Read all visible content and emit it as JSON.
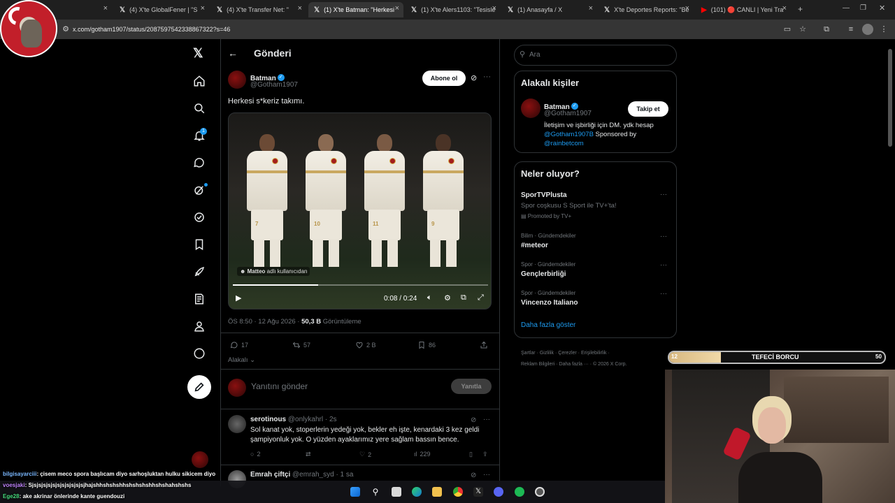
{
  "browser": {
    "tabs": [
      {
        "label": "X'te GlobalFener | \"S",
        "icon": "x-logo"
      },
      {
        "label": "(4) X'te GlobalFener | \"S",
        "icon": "x-logo"
      },
      {
        "label": "(4) X'te Transfer Net: \"",
        "icon": "x-logo"
      },
      {
        "label": "(1) X'te Batman: \"Herkesi",
        "icon": "x-logo",
        "active": true
      },
      {
        "label": "(1) X'te Alers1103: \"Tesisle",
        "icon": "x-logo"
      },
      {
        "label": "(1) Anasayfa / X",
        "icon": "x-logo"
      },
      {
        "label": "X'te Deportes Reports: \"Be",
        "icon": "x-logo"
      },
      {
        "label": "(101) 🔴 CANLI | Yeni Tra",
        "icon": "youtube-logo"
      }
    ],
    "new_tab": "+",
    "url": "x.com/gotham1907/status/2087597542338867322?s=46"
  },
  "sidebar": {
    "notification_count": "1",
    "items": [
      "home-icon",
      "search-icon",
      "bell-icon",
      "message-icon",
      "grok-icon",
      "verified-icon",
      "bookmark-icon",
      "rocket-icon",
      "list-icon",
      "profile-icon",
      "more-icon"
    ]
  },
  "post": {
    "header_title": "Gönderi",
    "back": "←",
    "author_name": "Batman",
    "author_handle": "@Gotham1907",
    "subscribe_label": "Abone ol",
    "text": "Herkesi s*keriz takımı.",
    "video": {
      "credit_user": "Matteo",
      "credit_suffix": "adlı kullanıcıdan",
      "time": "0:08 / 0:24",
      "progress": 0.333,
      "jersey_numbers": [
        "7",
        "10",
        "11",
        "9"
      ]
    },
    "meta_time": "ÖS 8:50 · 12 Ağu 2026 · ",
    "views": "50,3 B",
    "views_label": "Görüntüleme",
    "actions": {
      "replies": "17",
      "reposts": "57",
      "likes": "2 B",
      "bookmarks": "86"
    },
    "related": "Alakalı",
    "reply_placeholder": "Yanıtını gönder",
    "reply_button": "Yanıtla"
  },
  "comments": [
    {
      "name": "serotinous",
      "handle": "@onlykahrl",
      "age": "· 2s",
      "text": "Sol kanat yok, stoperlerin yedeği yok, bekler eh işte, kenardaki 3 kez geldi şampiyonluk yok. O yüzden ayaklarımız yere sağlam bassın bence.",
      "replies": "2",
      "likes": "2",
      "views": "229"
    },
    {
      "name": "Emrah çiftçi",
      "handle": "@emrah_syd",
      "age": "· 1 sa"
    }
  ],
  "right": {
    "search_placeholder": "Ara",
    "people_title": "Alakalı kişiler",
    "person": {
      "name": "Batman",
      "handle": "@Gotham1907",
      "follow_label": "Takip et",
      "bio_1": "İletişim ve işbirliği için DM. ydk hesap",
      "bio_link": "@Gotham1907B",
      "bio_2": " Sponsored by",
      "bio_link2": "@rainbetcom"
    },
    "trends_title": "Neler oluyor?",
    "promo": {
      "name": "SporTVPlusta",
      "desc": "Spor coşkusu S Sport ile TV+'ta!",
      "promoted": "Promoted by TV+"
    },
    "trends": [
      {
        "category": "Bilim · Gündemdekiler",
        "name": "#meteor"
      },
      {
        "category": "Spor · Gündemdekiler",
        "name": "Gençlerbirliği"
      },
      {
        "category": "Spor · Gündemdekiler",
        "name": "Vincenzo Italiano"
      }
    ],
    "show_more": "Daha fazla göster",
    "footer_1": "Şartlar · Gizlilik · Çerezler · Erişilebilirlik ·",
    "footer_2": "Reklam Bilgileri · Daha fazla ··· · © 2026 X Corp."
  },
  "overlay": {
    "debt_left": "12",
    "debt_title": "TEFECİ BORCU",
    "debt_right": "50",
    "debt_fraction": 0.24,
    "chat": [
      {
        "user": "bilgisayarciii",
        "color": "#7ab8ff",
        "text": ": çisem meco spora başlıcam diyo sarhoşluktan hulku sikicem diyo"
      },
      {
        "user": "voesjaki",
        "color": "#c084fc",
        "text": ": Sjsjsjsjsjsjsjsjsjsjsjsjhajshhshshshhshshshshhshshahshshs"
      },
      {
        "user": "Ege28",
        "color": "#4ade80",
        "text": ": ake akrinar önlerinde kante guendouzi"
      }
    ]
  }
}
